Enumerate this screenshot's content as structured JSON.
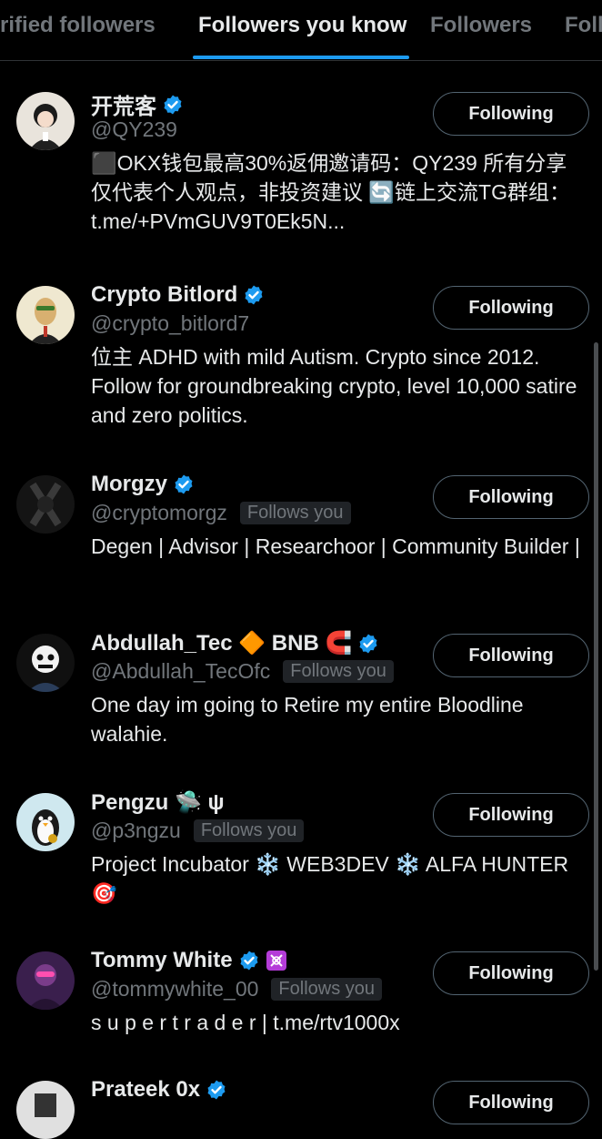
{
  "tabs": [
    {
      "label": "Verified followers"
    },
    {
      "label": "Followers you know"
    },
    {
      "label": "Followers"
    },
    {
      "label": "Following"
    }
  ],
  "follow_button_label": "Following",
  "follows_you_label": "Follows you",
  "users": [
    {
      "name": "开荒客",
      "handle": "@QY239",
      "verified": true,
      "follows_you": false,
      "bio": "⬛OKX钱包最高30%返佣邀请码：QY239 所有分享仅代表个人观点，非投资建议 🔄链上交流TG群组：t.me/+PVmGUV9T0Ek5N..."
    },
    {
      "name": "Crypto Bitlord",
      "handle": "@crypto_bitlord7",
      "verified": true,
      "follows_you": false,
      "bio": "位主 ADHD with mild Autism. Crypto since 2012. Follow for groundbreaking crypto, level 10,000 satire and zero politics."
    },
    {
      "name": "Morgzy",
      "handle": "@cryptomorgz",
      "verified": true,
      "follows_you": true,
      "bio": "Degen | Advisor | Researchoor | Community Builder |"
    },
    {
      "name": "Abdullah_Tec 🔶 BNB 🧲",
      "handle": "@Abdullah_TecOfc",
      "verified": true,
      "follows_you": true,
      "bio": "One day im going to Retire my entire Bloodline walahie."
    },
    {
      "name": "Pengzu 🛸 ψ",
      "handle": "@p3ngzu",
      "verified": false,
      "follows_you": true,
      "bio": "Project Incubator ❄️ WEB3DEV ❄️ ALFA HUNTER 🎯"
    },
    {
      "name": "Tommy White",
      "handle": "@tommywhite_00",
      "verified": true,
      "follows_you": true,
      "bio": "s u p e r t r a d e r | t.me/rtv1000x"
    },
    {
      "name": "Prateek 0x",
      "handle": "",
      "verified": true,
      "follows_you": false,
      "bio": ""
    }
  ],
  "colors": {
    "accent": "#1d9bf0",
    "background": "#000000",
    "text": "#e7e9ea",
    "muted": "#71767b"
  }
}
